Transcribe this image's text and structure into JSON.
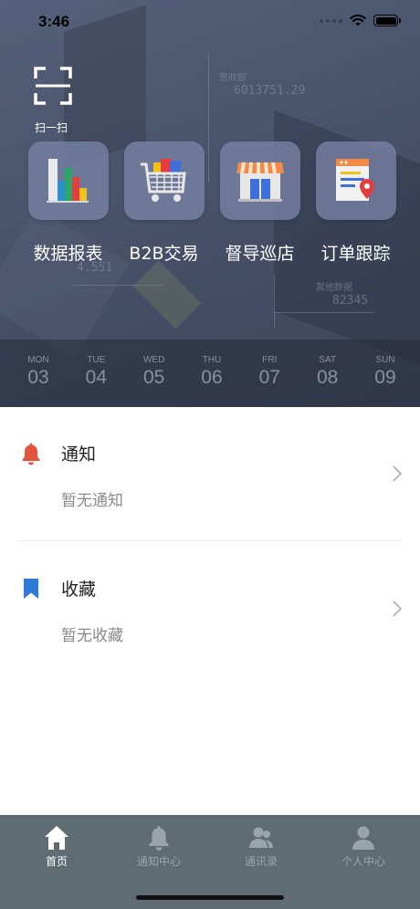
{
  "status_bar": {
    "time": "3:46"
  },
  "scan": {
    "label": "扫一扫"
  },
  "background_text": {
    "t1": "营收额",
    "t2": "6013751.29",
    "t3": "其他数据",
    "t4": "82345",
    "t5": "4.551"
  },
  "quick_actions": [
    {
      "label": "数据报表",
      "icon": "bar-chart-icon"
    },
    {
      "label": "B2B交易",
      "icon": "shopping-cart-icon"
    },
    {
      "label": "督导巡店",
      "icon": "storefront-icon"
    },
    {
      "label": "订单跟踪",
      "icon": "order-tracking-icon"
    }
  ],
  "week": [
    {
      "name": "MON",
      "num": "03"
    },
    {
      "name": "TUE",
      "num": "04"
    },
    {
      "name": "WED",
      "num": "05"
    },
    {
      "name": "THU",
      "num": "06"
    },
    {
      "name": "FRI",
      "num": "07"
    },
    {
      "name": "SAT",
      "num": "08"
    },
    {
      "name": "SUN",
      "num": "09"
    }
  ],
  "notice": {
    "title": "通知",
    "subtitle": "暂无通知",
    "icon": "bell-icon",
    "color": "#e2553b"
  },
  "favorites": {
    "title": "收藏",
    "subtitle": "暂无收藏",
    "icon": "bookmark-icon",
    "color": "#2f7ad6"
  },
  "tabs": [
    {
      "label": "首页",
      "icon": "home-icon",
      "active": true
    },
    {
      "label": "通知中心",
      "icon": "bell-icon",
      "active": false
    },
    {
      "label": "通讯录",
      "icon": "contacts-icon",
      "active": false
    },
    {
      "label": "个人中心",
      "icon": "person-icon",
      "active": false
    }
  ],
  "colors": {
    "tab_bar": "#5f6c74",
    "tab_active": "#ffffff",
    "tab_inactive": "#9aa4ab"
  }
}
